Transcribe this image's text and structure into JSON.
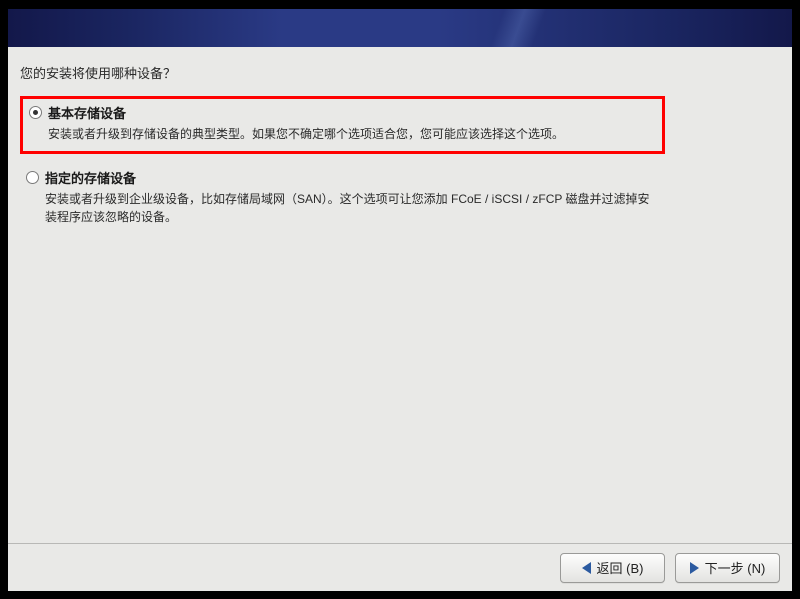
{
  "prompt": "您的安装将使用哪种设备？",
  "options": {
    "basic": {
      "title": "基本存储设备",
      "desc": "安装或者升级到存储设备的典型类型。如果您不确定哪个选项适合您，您可能应该选择这个选项。"
    },
    "specialized": {
      "title": "指定的存储设备",
      "desc": "安装或者升级到企业级设备，比如存储局域网（SAN）。这个选项可让您添加 FCoE / iSCSI / zFCP 磁盘并过滤掉安装程序应该忽略的设备。"
    }
  },
  "buttons": {
    "back": "返回 (B)",
    "next": "下一步 (N)"
  }
}
